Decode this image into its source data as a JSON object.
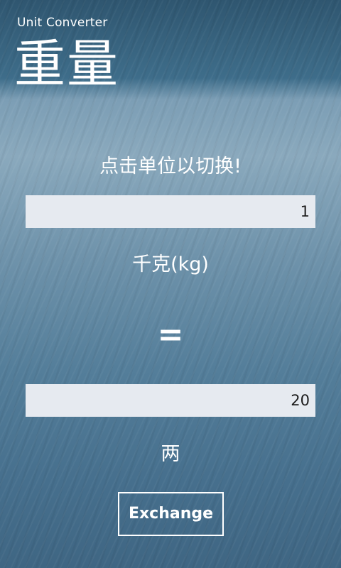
{
  "app": {
    "title": "Unit Converter"
  },
  "page": {
    "title": "重量"
  },
  "hint": "点击单位以切换!",
  "from": {
    "value": "1",
    "unit": "千克(kg)"
  },
  "equals_sign": "=",
  "to": {
    "value": "20",
    "unit": "两"
  },
  "exchange_button": {
    "label": "Exchange"
  },
  "colors": {
    "text": "#ffffff",
    "input_background": "#e6eaf0",
    "input_text": "#1c1c1c",
    "background_top": "#2f5670",
    "background_bottom": "#3f6683"
  }
}
